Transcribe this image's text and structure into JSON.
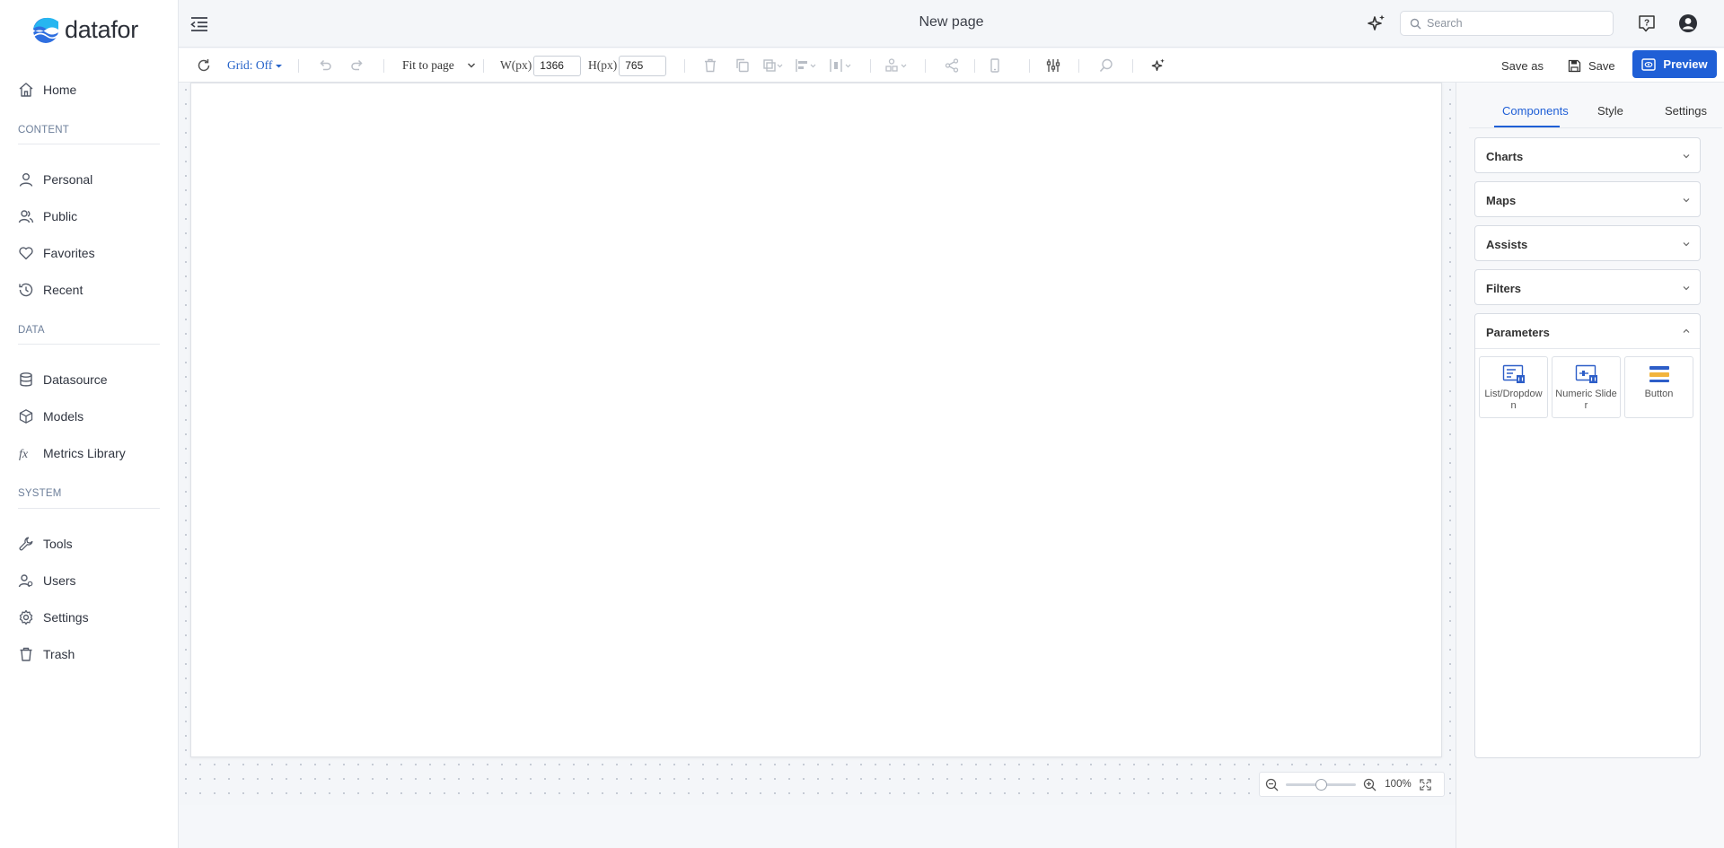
{
  "app": {
    "name": "datafor",
    "brand_color": "#1f5fd6"
  },
  "sidebar": {
    "home": "Home",
    "sections": [
      {
        "label": "CONTENT"
      },
      {
        "label": "DATA"
      },
      {
        "label": "SYSTEM"
      }
    ],
    "items": [
      {
        "label": "Personal",
        "icon": "user-icon"
      },
      {
        "label": "Public",
        "icon": "users-icon"
      },
      {
        "label": "Favorites",
        "icon": "heart-icon"
      },
      {
        "label": "Recent",
        "icon": "clock-icon"
      },
      {
        "label": "Datasource",
        "icon": "database-icon"
      },
      {
        "label": "Models",
        "icon": "cube-icon"
      },
      {
        "label": "Metrics Library",
        "icon": "fx-icon"
      },
      {
        "label": "Tools",
        "icon": "wrench-icon"
      },
      {
        "label": "Users",
        "icon": "users-icon"
      },
      {
        "label": "Settings",
        "icon": "gear-icon"
      },
      {
        "label": "Trash",
        "icon": "trash-icon"
      }
    ]
  },
  "header": {
    "title": "New page",
    "search_placeholder": "Search"
  },
  "toolbar": {
    "grid_label": "Grid: Off",
    "fit_label": "Fit to page",
    "width_label": "W(px)",
    "width_value": "1366",
    "height_label": "H(px)",
    "height_value": "765",
    "save_as_label": "Save as",
    "save_label": "Save",
    "preview_label": "Preview"
  },
  "zoom": {
    "percent": "100%",
    "level": 0.5
  },
  "right_panel": {
    "tabs": [
      "Components",
      "Style",
      "Settings"
    ],
    "active_tab": "Components",
    "sections": [
      "Charts",
      "Maps",
      "Assists",
      "Filters"
    ],
    "parameters": {
      "title": "Parameters",
      "components": [
        "List/Dropdown",
        "Numeric Slider",
        "Button"
      ]
    }
  }
}
